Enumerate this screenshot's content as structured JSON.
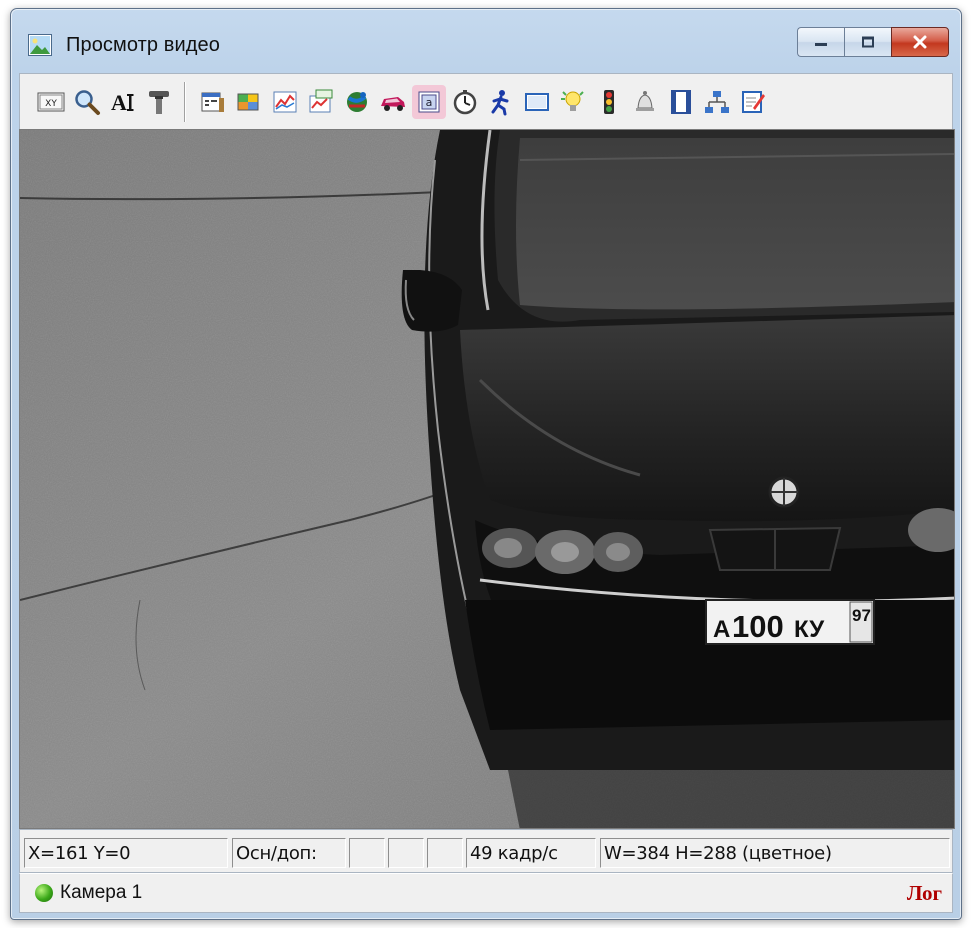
{
  "window": {
    "title": "Просмотр видео",
    "controls": {
      "minimize": "minimize-icon",
      "maximize": "maximize-icon",
      "close": "close-icon"
    }
  },
  "toolbar": {
    "icons": [
      {
        "name": "xy-coords-icon",
        "glyph": "XY"
      },
      {
        "name": "magnifier-icon"
      },
      {
        "name": "text-font-icon",
        "glyph": "A"
      },
      {
        "name": "tools-icon"
      },
      {
        "name": "properties-icon"
      },
      {
        "name": "palette-icon"
      },
      {
        "name": "graph-icon"
      },
      {
        "name": "graph-settings-icon"
      },
      {
        "name": "globe-network-icon"
      },
      {
        "name": "car-icon"
      },
      {
        "name": "plate-recognition-icon",
        "active": true
      },
      {
        "name": "stopwatch-icon"
      },
      {
        "name": "running-man-icon"
      },
      {
        "name": "window-frame-icon"
      },
      {
        "name": "light-bulb-icon"
      },
      {
        "name": "traffic-light-icon"
      },
      {
        "name": "bell-icon"
      },
      {
        "name": "film-icon"
      },
      {
        "name": "network-nodes-icon"
      },
      {
        "name": "edit-notes-icon"
      }
    ]
  },
  "video": {
    "plate_letters_1": "А",
    "plate_digits": "100",
    "plate_letters_2": "КУ",
    "plate_region": "97"
  },
  "status": {
    "coords": "X=161 Y=0",
    "main_extra": "Осн/доп:",
    "fps": "49 кадр/с",
    "resolution": "W=384 H=288 (цветное)"
  },
  "footer": {
    "camera_label": "Камера 1",
    "log_label": "Лог"
  },
  "colors": {
    "log_red": "#b00000",
    "status_green": "#3ba819",
    "active_highlight": "#f3c8d7"
  }
}
